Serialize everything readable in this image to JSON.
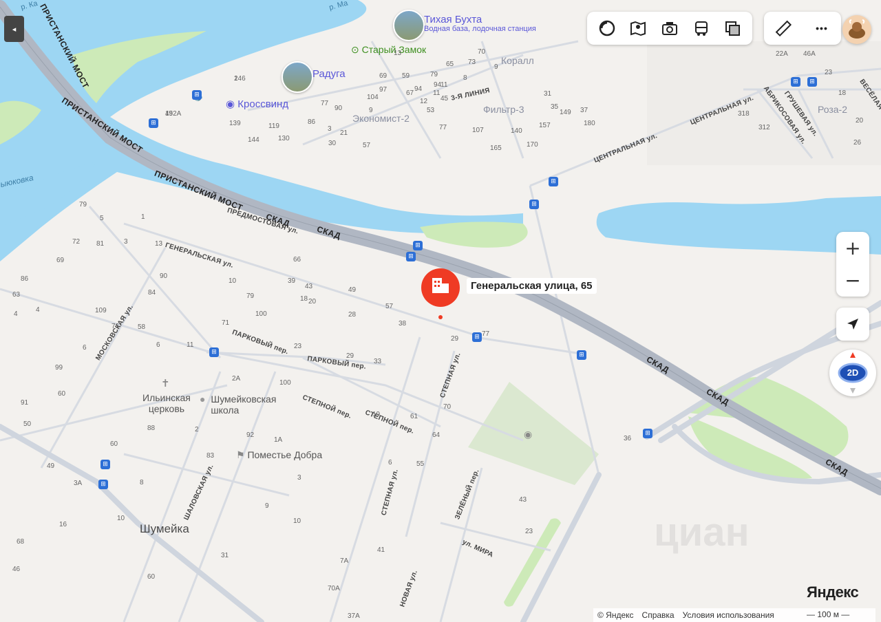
{
  "map": {
    "marker": {
      "label": "Генеральская улица, 65"
    },
    "districts": [
      {
        "name": "Шумейка",
        "style": "place-big"
      },
      {
        "name": "Коралл",
        "style": "place-gray"
      },
      {
        "name": "Фильтр-3",
        "style": "place-gray"
      },
      {
        "name": "Экономист-2",
        "style": "place-gray"
      },
      {
        "name": "Роза-2",
        "style": "place-gray"
      },
      {
        "name": "ыюковка",
        "style": "water"
      }
    ],
    "pois": [
      {
        "name": "Тихая Бухта",
        "sub": "Водная база, лодочная станция",
        "color": "blue",
        "photo": true
      },
      {
        "name": "Старый Замок",
        "color": "green"
      },
      {
        "name": "Радуга",
        "color": "blue",
        "photo": true
      },
      {
        "name": "Кроссвинд",
        "color": "blue"
      },
      {
        "name": "Шумейковская школа",
        "lines": [
          "Шумейковская",
          "школа"
        ],
        "color": "gray"
      },
      {
        "name": "Ильинская церковь",
        "lines": [
          "Ильинская",
          "церковь"
        ],
        "color": "gray"
      },
      {
        "name": "Поместье Добра",
        "color": "gray"
      }
    ],
    "roads": [
      {
        "name": "ПРИСТАНСКИЙ МОСТ"
      },
      {
        "name": "ПРИСТАНСКИЙ МОСТ"
      },
      {
        "name": "ПРИСТАНСКИЙ МОСТ"
      },
      {
        "name": "СКАД"
      },
      {
        "name": "СКАД"
      },
      {
        "name": "СКАД"
      },
      {
        "name": "СКАД"
      },
      {
        "name": "СКАД"
      }
    ],
    "streets": [
      "ПРЕДМОСТОВАЯ ул.",
      "ГЕНЕРАЛЬСКАЯ ул.",
      "МОСКОВСКАЯ ул.",
      "ПАРКОВЫЙ пер.",
      "ПАРКОВЫЙ пер.",
      "СТЕПНОЙ пер.",
      "СТЕПНОЙ пер.",
      "СТЕПНАЯ ул.",
      "СТЕПНАЯ ул.",
      "ШАЛОВСКАЯ ул.",
      "ЗЕЛЁНЫЙ пер.",
      "ул. МИРА",
      "НОВАЯ ул.",
      "ЦЕНТРАЛЬНАЯ ул.",
      "ЦЕНТРАЛЬНАЯ ул.",
      "АБРИКОСОВАЯ ул.",
      "ГРУШЕВАЯ ул.",
      "3-Я ЛИНИЯ",
      "ВЕСЁЛАЯ",
      "р. Ка",
      "р. Ма"
    ],
    "houses": [
      "146",
      "152A",
      "139",
      "144",
      "119",
      "130",
      "86",
      "77",
      "90",
      "3",
      "9",
      "97",
      "104",
      "69",
      "59",
      "79",
      "11",
      "94",
      "8",
      "12",
      "94",
      "11",
      "45",
      "53",
      "70",
      "65",
      "73",
      "9",
      "31",
      "35",
      "37",
      "149",
      "180",
      "157",
      "107",
      "140",
      "170",
      "165",
      "77",
      "30",
      "57",
      "21",
      "13",
      "67",
      "22А",
      "46А",
      "23",
      "318",
      "312",
      "18",
      "20",
      "26",
      "79",
      "5",
      "1",
      "72",
      "81",
      "69",
      "3",
      "13",
      "66",
      "86",
      "90",
      "10",
      "43",
      "63",
      "84",
      "39",
      "18",
      "20",
      "79",
      "71",
      "109",
      "100",
      "28",
      "4",
      "76",
      "6",
      "11",
      "23",
      "29",
      "33",
      "38",
      "57",
      "49",
      "99",
      "60",
      "2A",
      "100",
      "91",
      "50",
      "88",
      "2",
      "92",
      "1A",
      "83",
      "3",
      "61",
      "64",
      "70",
      "6",
      "55",
      "60",
      "49",
      "8",
      "3A",
      "43",
      "23",
      "19",
      "9",
      "10",
      "10",
      "16",
      "68",
      "31",
      "7A",
      "41",
      "46",
      "60",
      "70A",
      "37A",
      "36",
      "29",
      "77",
      "6",
      "58",
      "4",
      "2",
      "49"
    ],
    "bus_stop_count": 14,
    "icons": [
      "anchor-icon",
      "church-icon",
      "school-icon",
      "flag-icon",
      "monument-icon"
    ]
  },
  "ui": {
    "back_button": "◂",
    "toolbar": [
      {
        "name": "layers-icon"
      },
      {
        "name": "map-mode-icon"
      },
      {
        "name": "panorama-icon"
      },
      {
        "name": "transport-icon"
      },
      {
        "name": "map-layers-icon"
      }
    ],
    "toolbar2": [
      {
        "name": "ruler-icon"
      },
      {
        "name": "more-icon",
        "label": "•••"
      }
    ],
    "zoom_in": "+",
    "zoom_out": "−",
    "view_mode": "2D",
    "logo": "Яндекс",
    "footer": {
      "copyright": "© Яндекс",
      "help": "Справка",
      "terms": "Условия использования"
    },
    "scale": "100 м",
    "watermark": "циан",
    "colors": {
      "water": "#9dd6f3",
      "land": "#f3f1ee",
      "road_major": "#b0b7c3",
      "road_minor": "#d7dbe2",
      "park": "#cdeab8",
      "marker": "#ef3b24",
      "bus": "#2d6fd6"
    }
  }
}
